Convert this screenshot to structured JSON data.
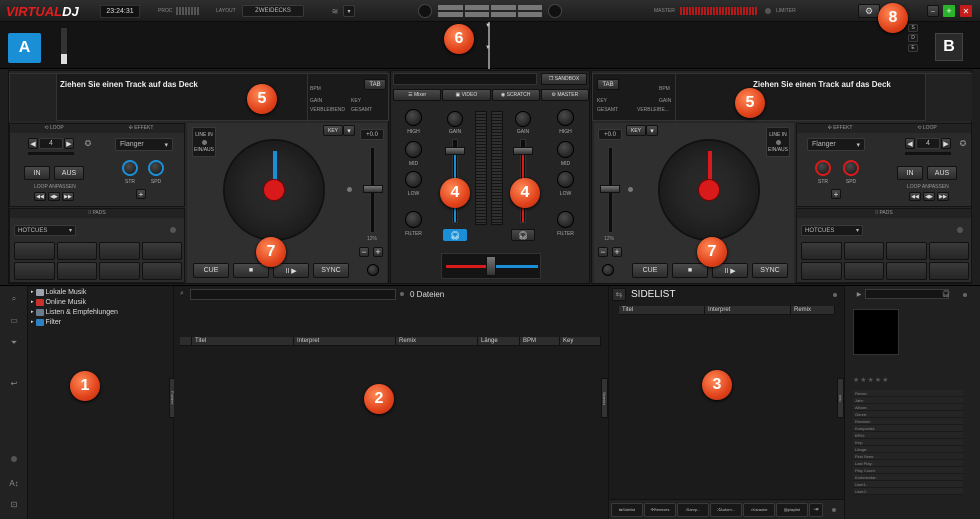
{
  "app": {
    "logo_a": "VIRTUAL",
    "logo_b": "DJ",
    "clock": "23:24:31",
    "layout_label": "LAYOUT",
    "layout_value": "ZWEIDECKS",
    "master_label": "MASTER",
    "limiter_label": "LIMITER",
    "proc_label": "Proc"
  },
  "deck_a": {
    "indicator": "A",
    "title": "Ziehen Sie einen Track auf das Deck",
    "bpm_label": "BPM",
    "tab_label": "TAB",
    "gain_label": "GAIN",
    "key_label": "KEY",
    "remain_label": "VERBLEIBEND",
    "total_label": "GESAMT",
    "loop_label": "LOOP",
    "effect_label": "EFFEKT",
    "loop_value": "4",
    "in_label": "IN",
    "out_label": "AUS",
    "loop_adjust_label": "LOOP ANPASSEN",
    "effect_value": "Flanger",
    "str_label": "STR",
    "spd_label": "SPD",
    "pads_label": "PADS",
    "hotcues_label": "HOTCUES",
    "linein_label": "LINE IN",
    "linein_state": "EIN/AUS",
    "key_button": "KEY",
    "pitch_value": "+0.0",
    "pitch_range": "12%",
    "cue": "CUE",
    "stop": "■",
    "play": "II ▶",
    "sync": "SYNC"
  },
  "deck_b": {
    "indicator": "B",
    "title": "Ziehen Sie einen Track auf das Deck",
    "tab_label": "TAB",
    "bpm_label": "BPM",
    "key_label": "KEY",
    "gain_label": "GAIN",
    "total_label": "GESAMT",
    "remain_label": "VERBLEIBE...",
    "loop_label": "LOOP",
    "effect_label": "EFFEKT",
    "loop_value": "4",
    "in_label": "IN",
    "out_label": "AUS",
    "loop_adjust_label": "LOOP ANPASSEN",
    "effect_value": "Flanger",
    "str_label": "STR",
    "spd_label": "SPD",
    "pads_label": "PADS",
    "hotcues_label": "HOTCUES",
    "linein_label": "LINE IN",
    "linein_state": "EIN/AUS",
    "key_button": "KEY",
    "pitch_value": "+0.0",
    "pitch_range": "12%",
    "cue": "CUE",
    "stop": "■",
    "play": "II ▶",
    "sync": "SYNC"
  },
  "mixer": {
    "sandbox": "SANDBOX",
    "tab_mixer": "Mixer",
    "tab_video": "VIDEO",
    "tab_scratch": "SCRATCH",
    "tab_master": "MASTER",
    "gain": "GAIN",
    "high": "HIGH",
    "mid": "MID",
    "low": "LOW",
    "filter": "FILTER"
  },
  "browser": {
    "tree": [
      "Lokale Musik",
      "Online Musik",
      "Listen & Empfehlungen",
      "Filter"
    ],
    "file_count": "0 Dateien",
    "columns": [
      "Titel",
      "Interpret",
      "Remix",
      "Länge",
      "BPM",
      "Key"
    ],
    "folders_tab": "Folders",
    "sidelist_tab": "Sidelist",
    "info_tab": "Info"
  },
  "sidelist": {
    "title": "SIDELIST",
    "columns": [
      "Titel",
      "Interpret",
      "Remix"
    ],
    "bottom_tabs": [
      "Sidelist",
      "Remixes",
      "Samp...",
      "Autom...",
      "Karaoke",
      "playlist"
    ]
  },
  "info": {
    "stars": "★★★★★",
    "fields": [
      "Remix:",
      "Jahr:",
      "Album:",
      "Genre:",
      "Remixer:",
      "Komponist:",
      "BPM:",
      "Key:",
      "Länge:",
      "First Seen:",
      "Last Play:",
      "Play Count:",
      "Kommentar:",
      "User1:",
      "User2:"
    ]
  },
  "badges": [
    "1",
    "2",
    "3",
    "4",
    "4",
    "5",
    "5",
    "6",
    "7",
    "7",
    "8"
  ],
  "colors": {
    "accent_blue": "#1a8fd6",
    "accent_red": "#d91a1a",
    "badge": "#e0421b"
  }
}
